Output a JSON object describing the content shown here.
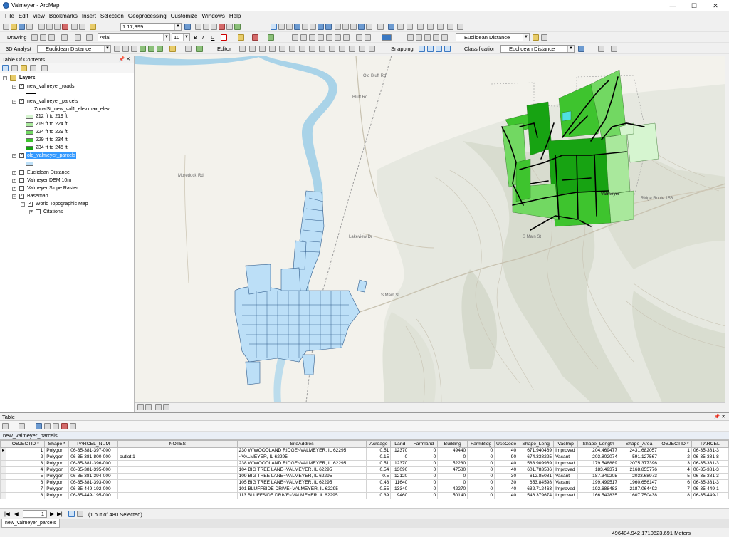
{
  "window": {
    "title": "Valmeyer - ArcMap",
    "minimize": "—",
    "maximize": "☐",
    "close": "✕"
  },
  "menu": [
    "File",
    "Edit",
    "View",
    "Bookmarks",
    "Insert",
    "Selection",
    "Geoprocessing",
    "Customize",
    "Windows",
    "Help"
  ],
  "toolbar": {
    "scale": "1:17,399",
    "drawing_label": "Drawing",
    "font_name": "Arial",
    "font_size": "10",
    "bold": "B",
    "italic": "I",
    "underline": "U",
    "euclidean_distance": "Euclidean Distance",
    "analyst_label": "3D Analyst",
    "editor_label": "Editor",
    "snapping_label": "Snapping",
    "classification_label": "Classification"
  },
  "toc": {
    "title": "Table Of Contents",
    "pin": "📌 ✕",
    "layers_label": "Layers",
    "roads": "new_valmeyer_roads",
    "parcels": "new_valmeyer_parcels",
    "field": "ZonalSt_new_val1_elev.max_elev",
    "classes": [
      {
        "label": "212 ft to 219 ft",
        "color": "#d6f5d0"
      },
      {
        "label": "219 ft to 224 ft",
        "color": "#a9e89c"
      },
      {
        "label": "224 ft to 229 ft",
        "color": "#72d862"
      },
      {
        "label": "229 ft to 234 ft",
        "color": "#3ec42e"
      },
      {
        "label": "234 ft to 245 ft",
        "color": "#17a312"
      }
    ],
    "old_parcels": "old_valmeyer_parcels",
    "old_parcels_color": "#bcdff7",
    "euclid": "Euclidean Distance",
    "dem": "Valmeyer DEM 10m",
    "slope": "Valmeyer Slope Raster",
    "basemap": "Basemap",
    "topo": "World Topographic Map",
    "citations": "Citations"
  },
  "map": {
    "labels": {
      "ridge": "Ridge Route 156",
      "moredock": "Moredock Rd",
      "main": "S Main St",
      "valmeyer": "Valmeyer",
      "lakeview": "Lakeview Dr",
      "bluff": "Bluff Rd",
      "oldbluff": "Old Bluff Rd"
    }
  },
  "table": {
    "title": "Table",
    "pin": "📌 ✕",
    "tab": "new_valmeyer_parcels",
    "columns": [
      "OBJECTID *",
      "Shape *",
      "PARCEL_NUM",
      "NOTES",
      "SiteAddres",
      "Acreage",
      "Land",
      "Farmland",
      "Building",
      "FarmBldg",
      "UseCode",
      "Shape_Leng",
      "VacImp",
      "Shape_Length",
      "Shape_Area",
      "OBJECTID *",
      "PARCEL"
    ],
    "rows": [
      [
        "1",
        "Polygon",
        "06-35-381-397-000",
        "",
        "230 W WOODLAND RIDGE~VALMEYER, IL 62295",
        "0.51",
        "12370",
        "0",
        "49440",
        "0",
        "40",
        "671.940469",
        "Improved",
        "204.469477",
        "2431.682057",
        "1",
        "06-35-381-3"
      ],
      [
        "2",
        "Polygon",
        "06-35-381-800-000",
        "outlot 1",
        "~VALMEYER, IL 62295",
        "0.15",
        "0",
        "0",
        "0",
        "0",
        "90",
        "674.338225",
        "Vacant",
        "203.802074",
        "591.127567",
        "2",
        "06-35-381-8"
      ],
      [
        "3",
        "Polygon",
        "06-35-381-396-000",
        "",
        "238 W WOODLAND RIDGE~VALMEYER, IL 62295",
        "0.51",
        "12370",
        "0",
        "52230",
        "0",
        "40",
        "588.909969",
        "Improved",
        "179.548889",
        "2075.377396",
        "3",
        "06-35-381-3"
      ],
      [
        "4",
        "Polygon",
        "06-35-381-395-000",
        "",
        "104 BIG TREE LANE~VALMEYER, IL 62295",
        "0.54",
        "13090",
        "0",
        "47580",
        "0",
        "40",
        "601.783586",
        "Improved",
        "183.49371",
        "2168.855776",
        "4",
        "06-35-381-3"
      ],
      [
        "5",
        "Polygon",
        "06-35-381-394-000",
        "",
        "109 BIG TREE LANE~VALMEYER, IL 62295",
        "0.5",
        "12120",
        "0",
        "0",
        "0",
        "30",
        "612.85081",
        "Vacant",
        "187.349205",
        "2033.68973",
        "5",
        "06-35-381-3"
      ],
      [
        "6",
        "Polygon",
        "06-35-381-393-000",
        "",
        "105 BIG TREE LANE~VALMEYER, IL 62295",
        "0.48",
        "11640",
        "0",
        "0",
        "0",
        "30",
        "653.84598",
        "Vacant",
        "199.499517",
        "1960.656147",
        "6",
        "06-35-381-3"
      ],
      [
        "7",
        "Polygon",
        "06-35-449-192-000",
        "",
        "101 BLUFFSIDE DRIVE~VALMEYER, IL 62295",
        "0.55",
        "13340",
        "0",
        "42270",
        "0",
        "40",
        "632.712463",
        "Improved",
        "192.688483",
        "2187.064492",
        "7",
        "06-35-449-1"
      ],
      [
        "8",
        "Polygon",
        "06-35-449-195-000",
        "",
        "113 BLUFFSIDE DRIVE~VALMEYER, IL 62295",
        "0.39",
        "9460",
        "0",
        "50140",
        "0",
        "40",
        "546.379674",
        "Improved",
        "166.542835",
        "1607.750438",
        "8",
        "06-35-449-1"
      ]
    ],
    "nav_record": "1",
    "selection": "(1 out of 480 Selected)"
  },
  "status": {
    "coords": "496484.942  1710623.691 Meters"
  }
}
